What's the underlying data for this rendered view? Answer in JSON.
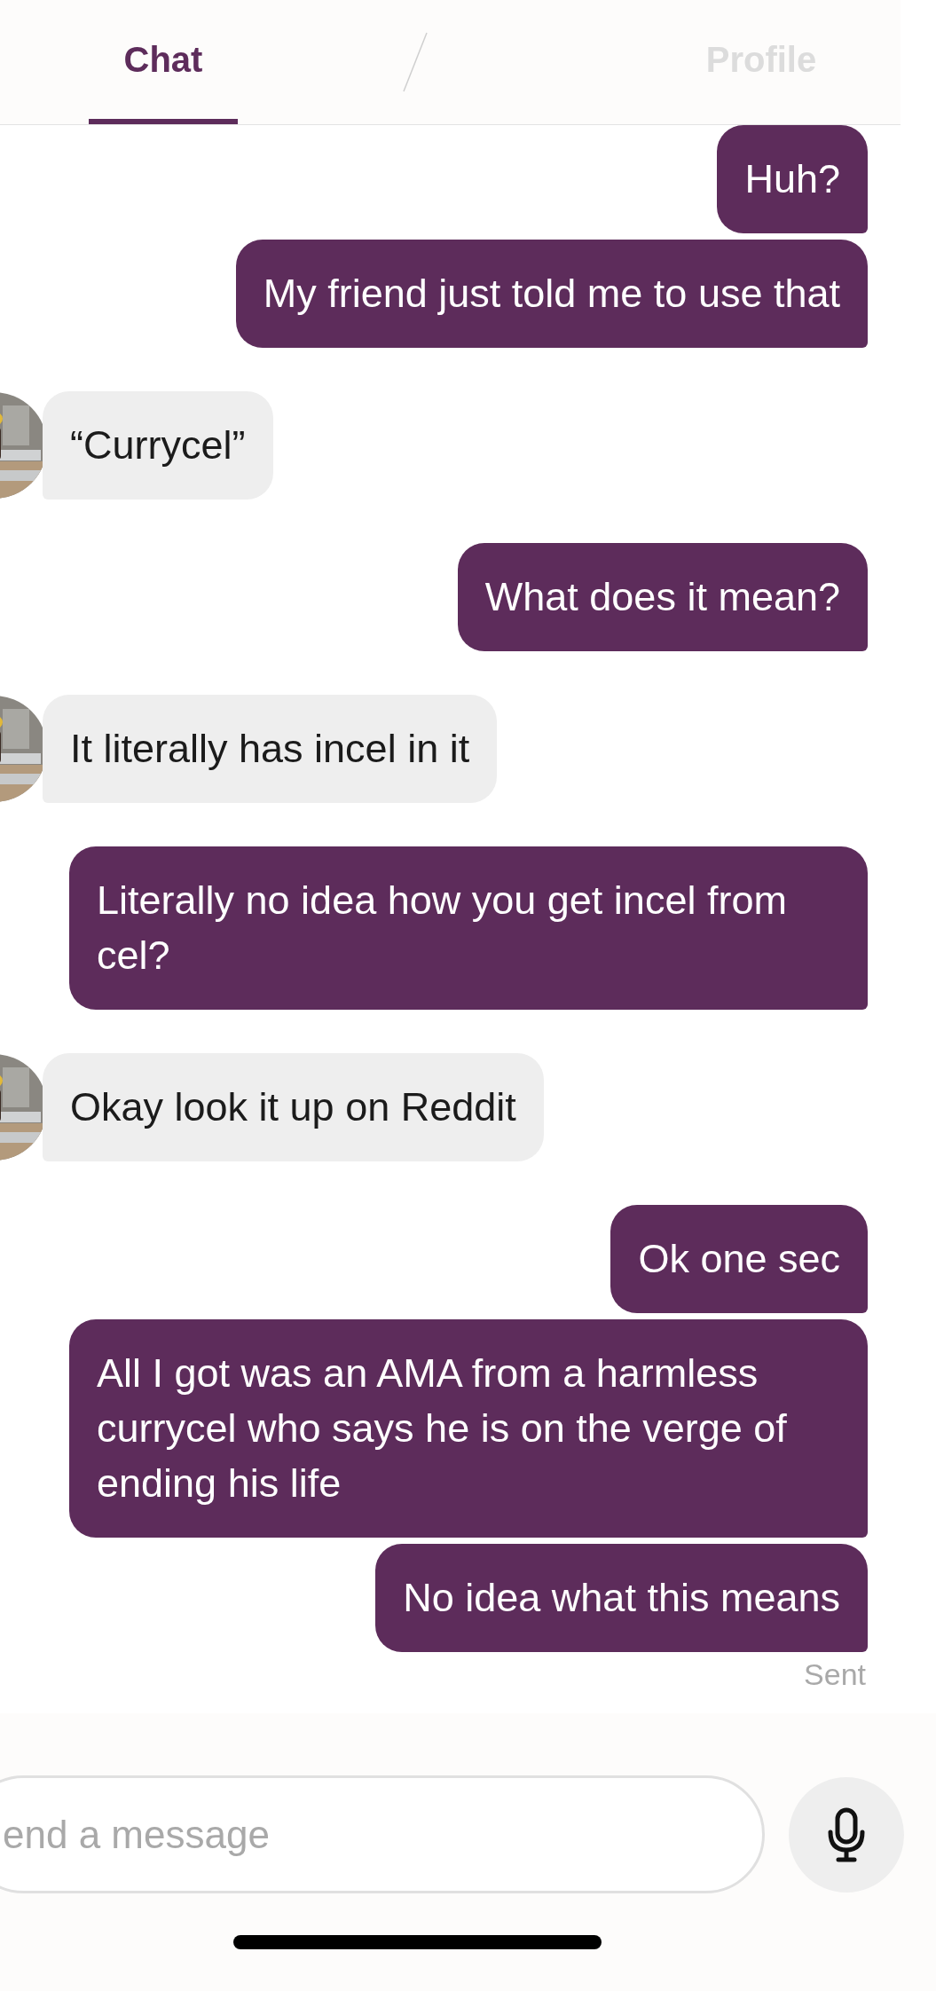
{
  "tabs": [
    {
      "label": "Chat",
      "selected": true
    },
    {
      "label": "Profile",
      "selected": false
    }
  ],
  "messages": [
    {
      "kind": "sent",
      "text": "Huh?"
    },
    {
      "kind": "sent",
      "text": "My friend just told me to use that"
    },
    {
      "kind": "received",
      "text": "“Currycel”"
    },
    {
      "kind": "sent",
      "text": "What does it mean?"
    },
    {
      "kind": "received",
      "text": "It literally has incel in it"
    },
    {
      "kind": "sent",
      "text": "Literally no idea how you get incel from cel?"
    },
    {
      "kind": "received",
      "text": "Okay look it up on Reddit"
    },
    {
      "kind": "sent",
      "text": "Ok one sec"
    },
    {
      "kind": "sent",
      "text": "All I got was an AMA from a harmless currycel who says he is on the verge of ending his life"
    },
    {
      "kind": "sent",
      "text": "No idea what this means"
    }
  ],
  "status": "Sent",
  "composer": {
    "placeholder": "end a message"
  }
}
